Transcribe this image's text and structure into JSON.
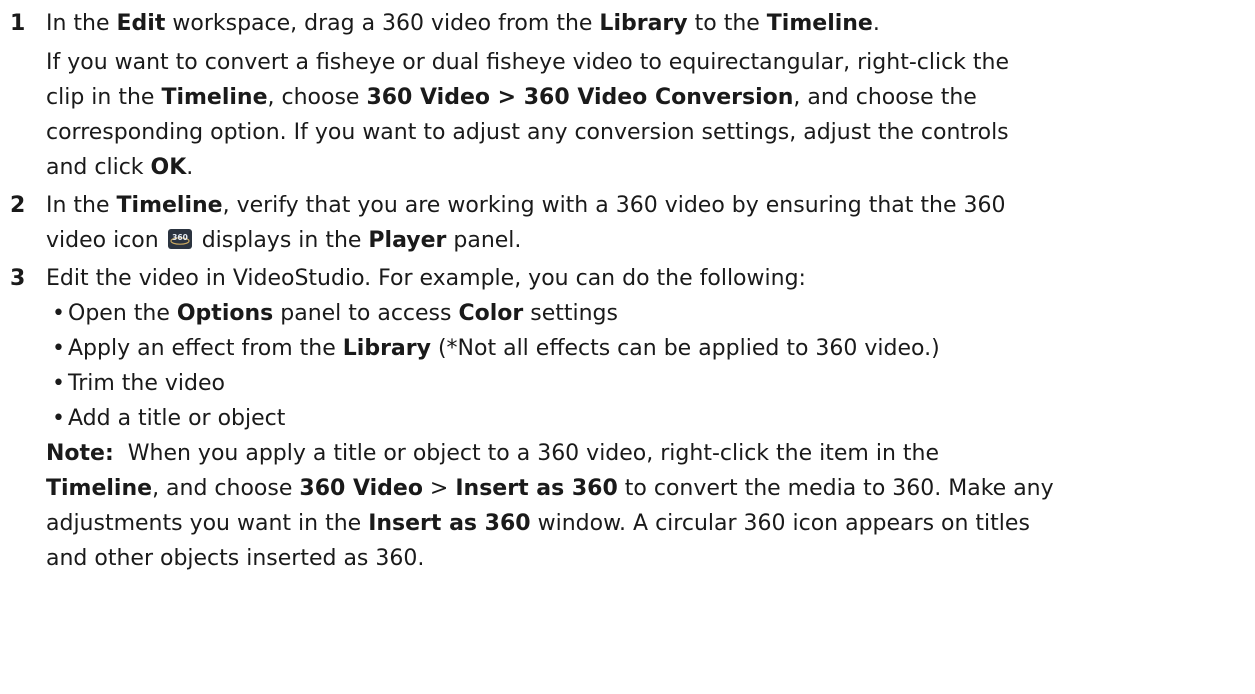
{
  "steps": [
    {
      "number": "1",
      "line1": {
        "a": "In the ",
        "b": "Edit",
        "c": " workspace, drag a 360 video from the ",
        "d": "Library",
        "e": " to the ",
        "f": "Timeline",
        "g": "."
      },
      "para": {
        "l1": "If you want to convert a fisheye or dual fisheye video to equirectangular, right-click the",
        "l2a": "clip in the ",
        "l2b": "Timeline",
        "l2c": ", choose ",
        "l2d": "360 Video > 360 Video Conversion",
        "l2e": ", and choose the",
        "l3": "corresponding option. If you want to adjust any conversion settings, adjust the controls",
        "l4a": "and click ",
        "l4b": "OK",
        "l4c": "."
      }
    },
    {
      "number": "2",
      "l1a": "In the ",
      "l1b": "Timeline",
      "l1c": ", verify that you are working with a 360 video by ensuring that the 360",
      "l2a": "video icon",
      "icon_name": "360-video-icon",
      "icon_text": "360",
      "l2b": " displays in the ",
      "l2c": "Player",
      "l2d": " panel."
    },
    {
      "number": "3",
      "intro": "Edit the video in VideoStudio. For example, you can do the following:",
      "bullet_char": "•",
      "bullets": [
        {
          "a": "Open the ",
          "b": "Options",
          "c": " panel to access ",
          "d": "Color",
          "e": " settings"
        },
        {
          "a": "Apply an effect from the ",
          "b": "Library",
          "c": " (*Not all effects can be applied to 360 video.)"
        },
        {
          "a": "Trim the video"
        },
        {
          "a": "Add a title or object"
        }
      ],
      "note": {
        "label": "Note:",
        "l1": "  When you apply a title or object to a 360 video, right-click the item in the",
        "l2a": "Timeline",
        "l2b": ", and choose ",
        "l2c": "360 Video",
        "l2d": " > ",
        "l2e": "Insert as 360",
        "l2f": " to convert the media to 360. Make any",
        "l3a": "adjustments you want in the ",
        "l3b": "Insert as 360",
        "l3c": " window. A circular 360 icon appears on titles",
        "l4": "and other objects inserted as 360."
      }
    }
  ]
}
